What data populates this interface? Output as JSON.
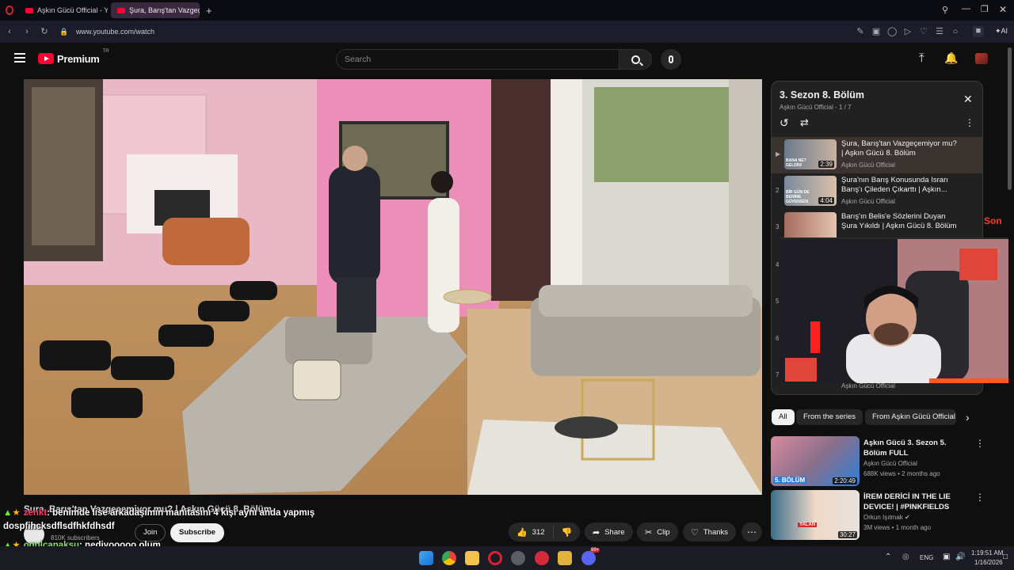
{
  "browser": {
    "tabs": [
      {
        "label": "Aşkın Gücü Official - YouT",
        "active": false
      },
      {
        "label": "Şura, Barış'tan Vazgeçemi",
        "active": true
      }
    ],
    "new_tab_label": "+",
    "url": "www.youtube.com/watch",
    "ai_label": "AI"
  },
  "youtube": {
    "logo_text": "Premium",
    "logo_region": "TR",
    "search_placeholder": "Search"
  },
  "playlist": {
    "title": "3. Sezon 8. Bölüm",
    "subtitle": "Aşkın Gücü Official - 1 / 7",
    "items": [
      {
        "index": "▶",
        "title": "Şura, Barış'tan Vazgeçemiyor mu? | Aşkın Gücü 8. Bölüm",
        "channel": "Aşkın Gücü Official",
        "duration": "2:39",
        "thumb_caption": "BANA NE? GELDİN!"
      },
      {
        "index": "2",
        "title": "Şura'nın Barış Konusunda Israrı Barış'ı Çileden Çıkarttı | Aşkın...",
        "channel": "Aşkın Gücü Official",
        "duration": "4:04",
        "thumb_caption": "BİR GÜN DE BENİME GÜVENSEN"
      },
      {
        "index": "3",
        "title": "Barış'ın Belis'e Sözlerini Duyan Şura Yıkıldı | Aşkın Gücü 8. Bölüm",
        "channel": "",
        "duration": "",
        "thumb_caption": ""
      },
      {
        "index": "4",
        "title": "",
        "channel": "",
        "duration": "",
        "thumb_caption": ""
      },
      {
        "index": "5",
        "title": "",
        "channel": "",
        "duration": "",
        "thumb_caption": ""
      },
      {
        "index": "6",
        "title": "",
        "channel": "",
        "duration": "",
        "thumb_caption": ""
      },
      {
        "index": "7",
        "title": "",
        "channel": "Aşkın Gücü Official",
        "duration": "",
        "thumb_caption": ""
      }
    ]
  },
  "side_overlay_text": "Son",
  "chips": [
    "All",
    "From the series",
    "From Aşkın Gücü Official"
  ],
  "recommended": [
    {
      "title": "Aşkın Gücü 3. Sezon 5. Bölüm FULL",
      "channel": "Aşkın Gücü Official",
      "meta": "688K views • 2 months ago",
      "duration": "2:20:49",
      "thumb_caption": "5. BÖLÜM"
    },
    {
      "title": "İREM DERİCİ IN THE LIE DEVICE! | #PINKFIELDS",
      "channel": "Orkun Işıtmak",
      "meta": "3M views • 1 month ago",
      "duration": "30:27",
      "thumb_caption": "YALAN"
    }
  ],
  "video": {
    "title": "Şura, Barış'tan Vazgeçemiyor mu? | Aşkın Gücü 8. Bölüm",
    "subscribers": "810K subscribers",
    "join_label": "Join",
    "subscribe_label": "Subscribe",
    "likes": "312",
    "share_label": "Share",
    "clip_label": "Clip",
    "thanks_label": "Thanks"
  },
  "chat": [
    {
      "user": "zenkt",
      "message": ": benimde lise arkadaşımın manitasını 4 kişi aynı anda yapmış",
      "user_color": "#ff3b6b"
    },
    {
      "user": "",
      "message": "dospfihcksdflsdfhkfdhsdf",
      "user_color": "#ffffff"
    },
    {
      "user": "ogulcanaksu",
      "message": ": nediyooooo olum",
      "user_color": "#8ee06a"
    }
  ],
  "taskbar": {
    "language": "ENG",
    "time": "1:19:51 AM",
    "date": "1/16/2026",
    "badge": "99+"
  }
}
